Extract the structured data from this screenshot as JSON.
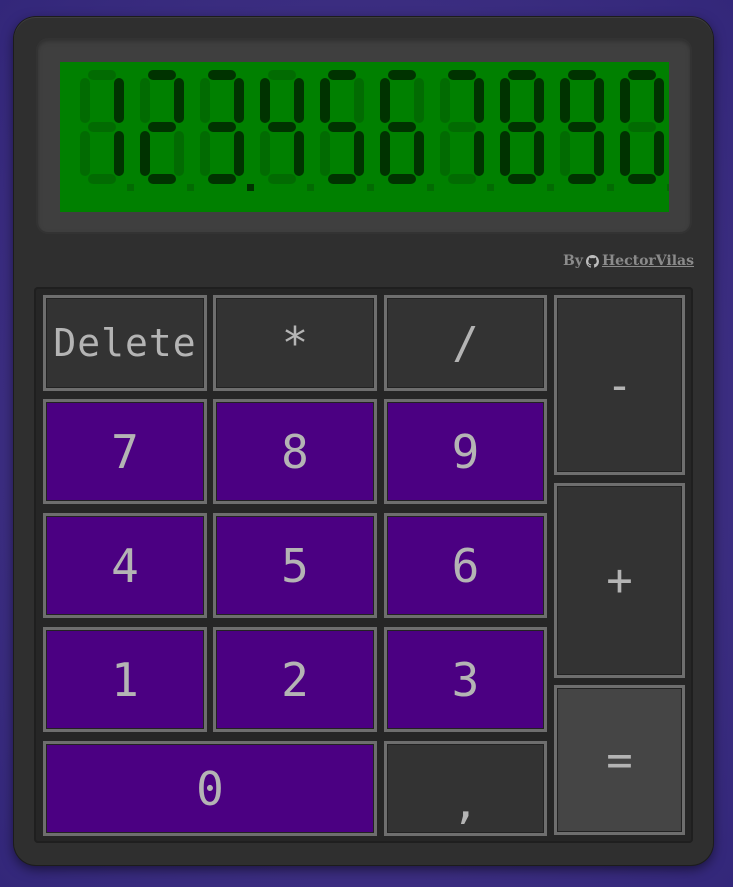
{
  "display": {
    "value": "1234567890",
    "lcd_bg": "#008000",
    "segment_on": "#003300",
    "segment_off": "#026b02"
  },
  "credit": {
    "prefix": "By",
    "icon": "github-icon",
    "author": "HectorVilas"
  },
  "keys": {
    "delete": "Delete",
    "multiply": "*",
    "divide": "/",
    "subtract": "-",
    "add": "+",
    "equals": "=",
    "seven": "7",
    "eight": "8",
    "nine": "9",
    "four": "4",
    "five": "5",
    "six": "6",
    "one": "1",
    "two": "2",
    "three": "3",
    "zero": "0",
    "decimal": ","
  },
  "colors": {
    "background": "#3d2f86",
    "number_key": "#4b0082",
    "operator_key": "#333333",
    "equals_key": "#454545",
    "key_border": "#6e6e6e",
    "key_text": "#b4b4b4"
  }
}
